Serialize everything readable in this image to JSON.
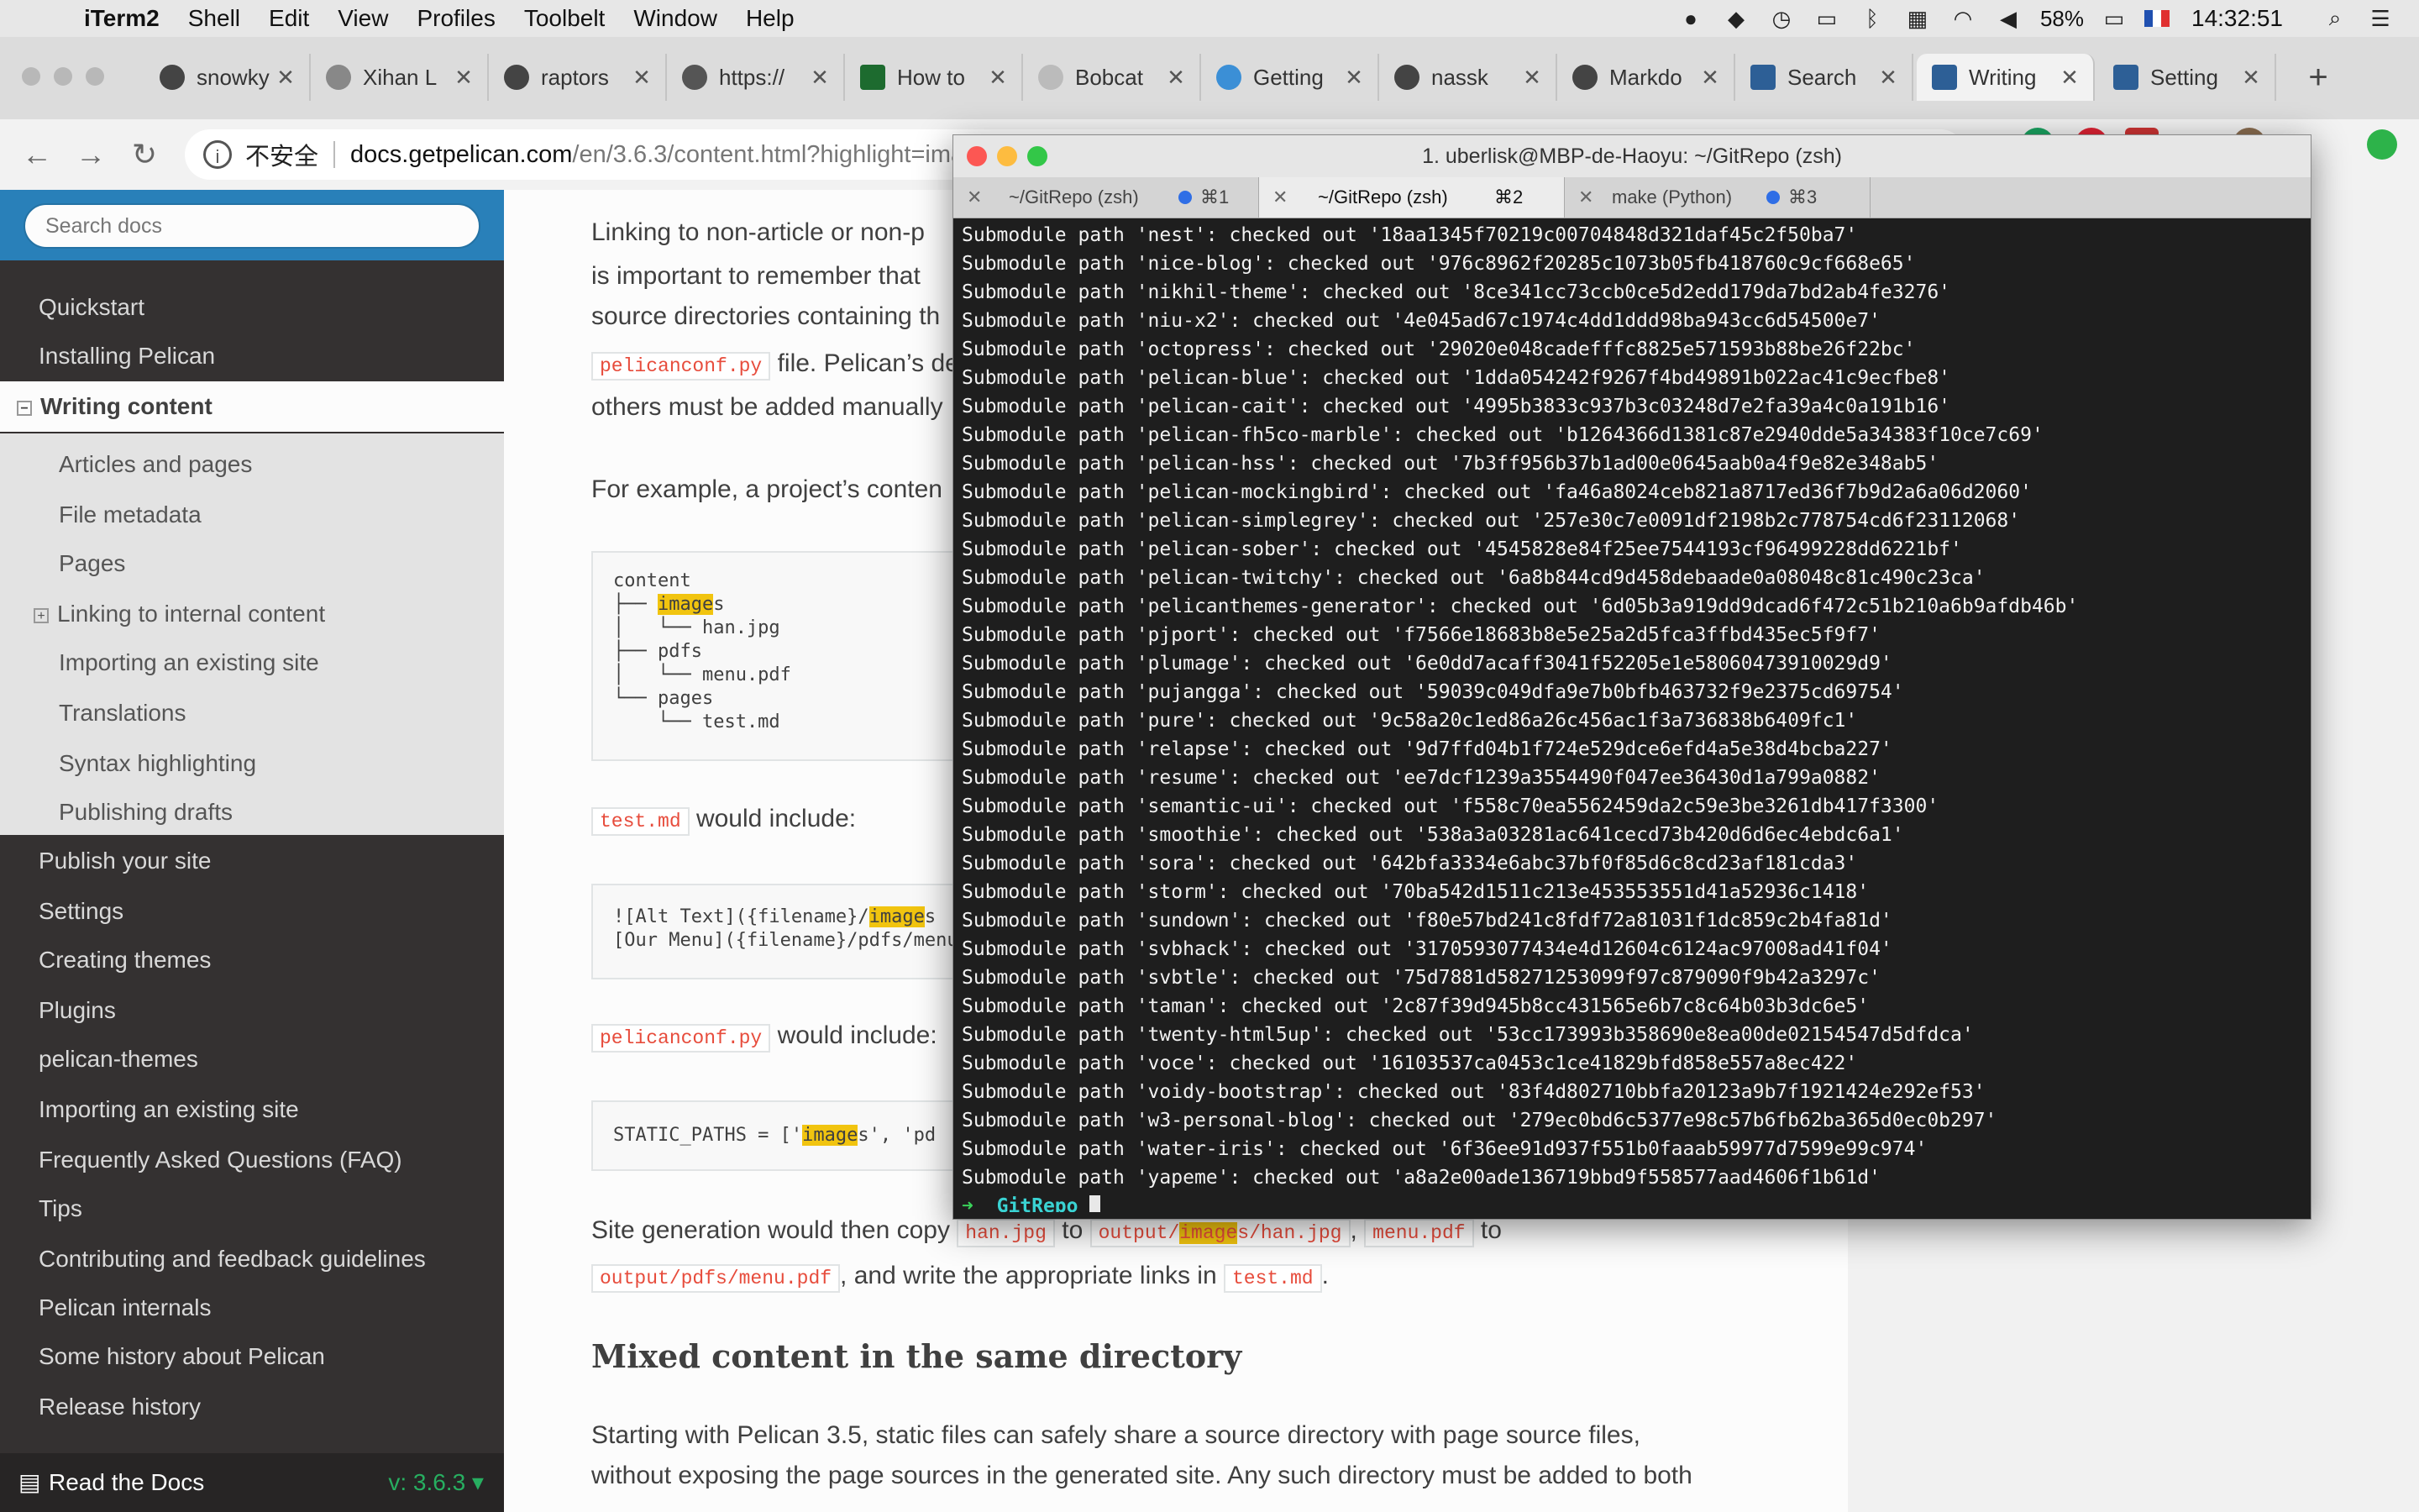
{
  "menubar": {
    "app": "iTerm2",
    "items": [
      "Shell",
      "Edit",
      "View",
      "Profiles",
      "Toolbelt",
      "Window",
      "Help"
    ],
    "battery": "58%",
    "clock": "14:32:51"
  },
  "browser": {
    "tabs": [
      {
        "label": "snowky"
      },
      {
        "label": "Xihan L"
      },
      {
        "label": "raptors"
      },
      {
        "label": "https://"
      },
      {
        "label": "How to"
      },
      {
        "label": "Bobcat"
      },
      {
        "label": "Getting"
      },
      {
        "label": "nassk"
      },
      {
        "label": "Markdo"
      },
      {
        "label": "Search"
      },
      {
        "label": "Writing"
      },
      {
        "label": "Setting"
      }
    ],
    "omnibox": {
      "security": "不安全",
      "host": "docs.getpelican.com",
      "path": "/en/3.6.3/content.html?highlight=image"
    }
  },
  "sidebar": {
    "search_placeholder": "Search docs",
    "top_items": [
      "Quickstart",
      "Installing Pelican"
    ],
    "current": "Writing content",
    "sub_items": [
      "Articles and pages",
      "File metadata",
      "Pages",
      "Linking to internal content",
      "Importing an existing site",
      "Translations",
      "Syntax highlighting",
      "Publishing drafts"
    ],
    "bottom_items": [
      "Publish your site",
      "Settings",
      "Creating themes",
      "Plugins",
      "pelican-themes",
      "Importing an existing site",
      "Frequently Asked Questions (FAQ)",
      "Tips",
      "Contributing and feedback guidelines",
      "Pelican internals",
      "Some history about Pelican",
      "Release history"
    ],
    "rtd_label": "Read the Docs",
    "version": "v: 3.6.3"
  },
  "content": {
    "p1_l1": "Linking to non-article or non-p",
    "p1_l2": "is important to remember that",
    "p1_l3": "source directories containing th",
    "p1_l4_code": "pelicanconf.py",
    "p1_l4_text": " file. Pelican’s de",
    "p1_l5": "others must be added manually",
    "p2": "For example, a project’s conten",
    "tree": {
      "l1": "content",
      "l2_pre": "├── ",
      "l2_hl": "image",
      "l2_post": "s",
      "l3": "│   └── han.jpg",
      "l4": "├── pdfs",
      "l5": "│   └── menu.pdf",
      "l6": "└── pages",
      "l7": "    └── test.md"
    },
    "p3_code": "test.md",
    "p3_text": " would include:",
    "md_l1_pre": "![Alt Text]({filename}/",
    "md_l1_hl": "image",
    "md_l1_post": "s",
    "md_l2": "[Our Menu]({filename}/pdfs/menu",
    "p4_code": "pelicanconf.py",
    "p4_text": " would include:",
    "static_pre": "STATIC_PATHS = ['",
    "static_hl": "image",
    "static_post": "s', 'pd",
    "p5_text1": "Site generation would then copy ",
    "p5_code1": "han.jpg",
    "p5_text2": " to ",
    "p5_code2_pre": "output/",
    "p5_code2_hl": "image",
    "p5_code2_post": "s/han.jpg",
    "p5_text3": ", ",
    "p5_code3": "menu.pdf",
    "p5_text4": " to",
    "p6_code": "output/pdfs/menu.pdf",
    "p6_text1": ", and write the appropriate links in ",
    "p6_code2": "test.md",
    "p6_text2": ".",
    "h2": "Mixed content in the same directory",
    "p7_l1": "Starting with Pelican 3.5, static files can safely share a source directory with page source files,",
    "p7_l2": "without exposing the page sources in the generated site. Any such directory must be added to both"
  },
  "iterm": {
    "title": "1. uberlisk@MBP-de-Haoyu: ~/GitRepo (zsh)",
    "tabs": [
      {
        "label": "~/GitRepo (zsh)",
        "shortcut": "⌘1"
      },
      {
        "label": "~/GitRepo (zsh)",
        "shortcut": "⌘2"
      },
      {
        "label": "make (Python)",
        "shortcut": "⌘3"
      }
    ],
    "lines": [
      "Submodule path 'nest': checked out '18aa1345f70219c00704848d321daf45c2f50ba7'",
      "Submodule path 'nice-blog': checked out '976c8962f20285c1073b05fb418760c9cf668e65'",
      "Submodule path 'nikhil-theme': checked out '8ce341cc73ccb0ce5d2edd179da7bd2ab4fe3276'",
      "Submodule path 'niu-x2': checked out '4e045ad67c1974c4dd1ddd98ba943cc6d54500e7'",
      "Submodule path 'octopress': checked out '29020e048cadefffc8825e571593b88be26f22bc'",
      "Submodule path 'pelican-blue': checked out '1dda054242f9267f4bd49891b022ac41c9ecfbe8'",
      "Submodule path 'pelican-cait': checked out '4995b3833c937b3c03248d7e2fa39a4c0a191b16'",
      "Submodule path 'pelican-fh5co-marble': checked out 'b1264366d1381c87e2940dde5a34383f10ce7c69'",
      "Submodule path 'pelican-hss': checked out '7b3ff956b37b1ad00e0645aab0a4f9e82e348ab5'",
      "Submodule path 'pelican-mockingbird': checked out 'fa46a8024ceb821a8717ed36f7b9d2a6a06d2060'",
      "Submodule path 'pelican-simplegrey': checked out '257e30c7e0091df2198b2c778754cd6f23112068'",
      "Submodule path 'pelican-sober': checked out '4545828e84f25ee7544193cf96499228dd6221bf'",
      "Submodule path 'pelican-twitchy': checked out '6a8b844cd9d458debaade0a08048c81c490c23ca'",
      "Submodule path 'pelicanthemes-generator': checked out '6d05b3a919dd9dcad6f472c51b210a6b9afdb46b'",
      "Submodule path 'pjport': checked out 'f7566e18683b8e5e25a2d5fca3ffbd435ec5f9f7'",
      "Submodule path 'plumage': checked out '6e0dd7acaff3041f52205e1e58060473910029d9'",
      "Submodule path 'pujangga': checked out '59039c049dfa9e7b0bfb463732f9e2375cd69754'",
      "Submodule path 'pure': checked out '9c58a20c1ed86a26c456ac1f3a736838b6409fc1'",
      "Submodule path 'relapse': checked out '9d7ffd04b1f724e529dce6efd4a5e38d4bcba227'",
      "Submodule path 'resume': checked out 'ee7dcf1239a3554490f047ee36430d1a799a0882'",
      "Submodule path 'semantic-ui': checked out 'f558c70ea5562459da2c59e3be3261db417f3300'",
      "Submodule path 'smoothie': checked out '538a3a03281ac641cecd73b420d6d6ec4ebdc6a1'",
      "Submodule path 'sora': checked out '642bfa3334e6abc37bf0f85d6c8cd23af181cda3'",
      "Submodule path 'storm': checked out '70ba542d1511c213e453553551d41a52936c1418'",
      "Submodule path 'sundown': checked out 'f80e57bd241c8fdf72a81031f1dc859c2b4fa81d'",
      "Submodule path 'svbhack': checked out '3170593077434e4d12604c6124ac97008ad41f04'",
      "Submodule path 'svbtle': checked out '75d7881d58271253099f97c879090f9b42a3297c'",
      "Submodule path 'taman': checked out '2c87f39d945b8cc431565e6b7c8c64b03b3dc6e5'",
      "Submodule path 'twenty-html5up': checked out '53cc173993b358690e8ea00de02154547d5dfdca'",
      "Submodule path 'voce': checked out '16103537ca0453c1ce41829bfd858e557a8ec422'",
      "Submodule path 'voidy-bootstrap': checked out '83f4d802710bbfa20123a9b7f1921424e292ef53'",
      "Submodule path 'w3-personal-blog': checked out '279ec0bd6c5377e98c57b6fb62ba365d0ec0b297'",
      "Submodule path 'water-iris': checked out '6f36ee91d937f551b0faaab59977d7599e99c974'",
      "Submodule path 'yapeme': checked out 'a8a2e00ade136719bbd9f558577aad4606f1b61d'"
    ],
    "prompt_arrow": "➜",
    "prompt_dir": "GitRepo"
  },
  "colors": {
    "rtd_blue": "#2980b9",
    "sidebar_bg": "#343131",
    "code_red": "#e74c3c",
    "highlight": "#f1c40f",
    "prompt_green": "#3ad35a"
  }
}
